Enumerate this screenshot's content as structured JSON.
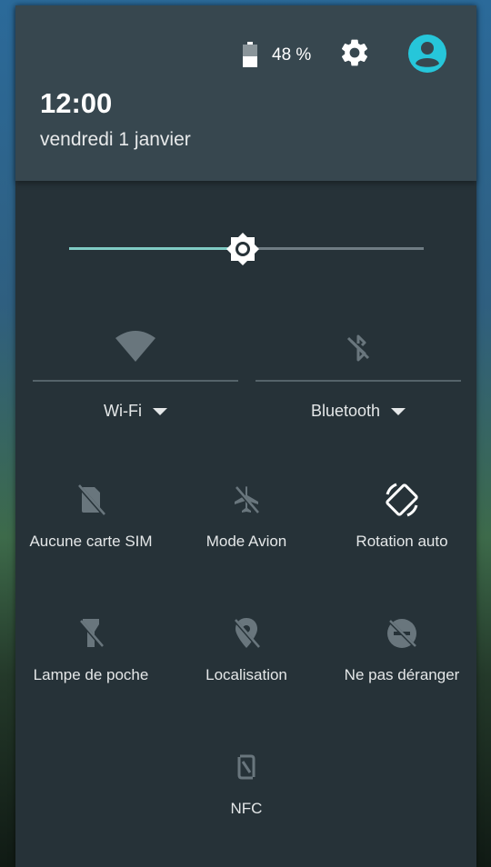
{
  "status": {
    "battery_percent": "48 %",
    "battery_level": 0.48
  },
  "header": {
    "time": "12:00",
    "date": "vendredi 1 janvier"
  },
  "brightness": {
    "level": 0.49
  },
  "tiles_large": [
    {
      "label": "Wi-Fi",
      "icon": "wifi-icon"
    },
    {
      "label": "Bluetooth",
      "icon": "bluetooth-off-icon"
    }
  ],
  "tiles": [
    {
      "label": "Aucune carte SIM",
      "icon": "no-sim-icon",
      "active": false
    },
    {
      "label": "Mode Avion",
      "icon": "airplane-mode-off-icon",
      "active": false
    },
    {
      "label": "Rotation auto",
      "icon": "auto-rotate-icon",
      "active": true
    },
    {
      "label": "Lampe de poche",
      "icon": "flashlight-off-icon",
      "active": false
    },
    {
      "label": "Localisation",
      "icon": "location-off-icon",
      "active": false
    },
    {
      "label": "Ne pas déranger",
      "icon": "do-not-disturb-off-icon",
      "active": false
    },
    {
      "label": "NFC",
      "icon": "nfc-icon",
      "active": false
    }
  ],
  "colors": {
    "panel": "#263238",
    "header": "#37474f",
    "accent": "#80cbc4",
    "avatar": "#26c6da",
    "icon_inactive": "#69767d",
    "icon_active": "#ffffff"
  }
}
